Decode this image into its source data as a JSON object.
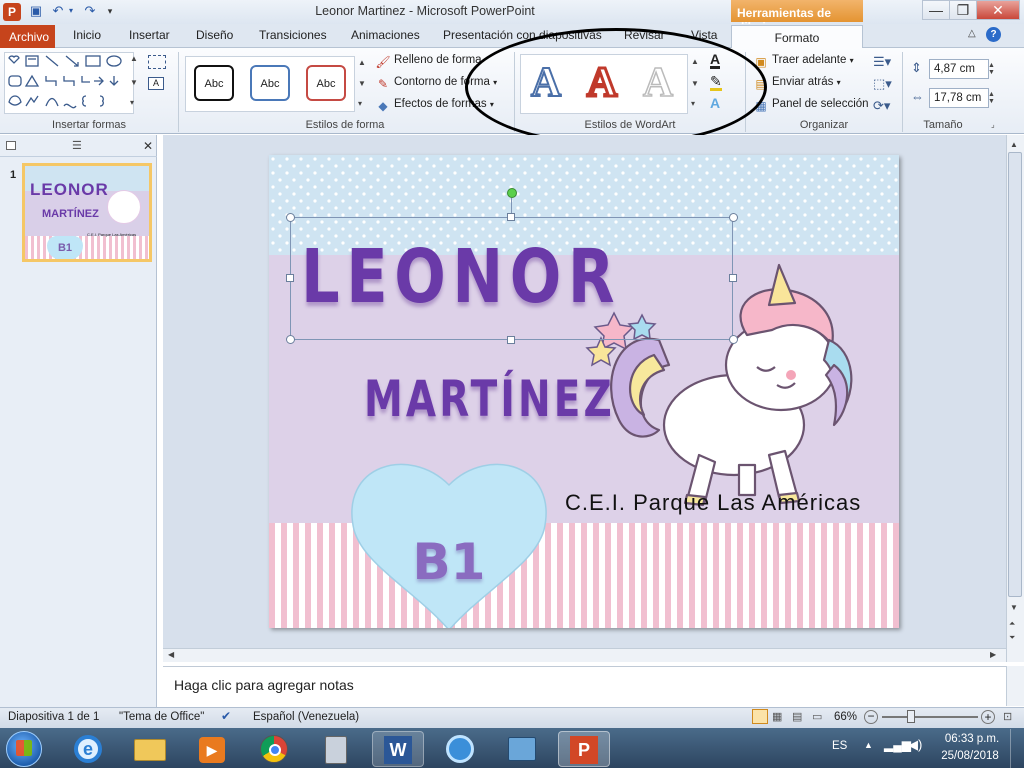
{
  "window": {
    "title": "Leonor Martinez  -  Microsoft PowerPoint",
    "context_tab_group": "Herramientas de dibujo",
    "min_symbol": "—",
    "max_symbol": "❐",
    "close_symbol": "✕"
  },
  "tabs": {
    "file": "Archivo",
    "items": [
      "Inicio",
      "Insertar",
      "Diseño",
      "Transiciones",
      "Animaciones",
      "Presentación con diapositivas",
      "Revisar",
      "Vista"
    ],
    "active": "Formato"
  },
  "ribbon": {
    "groups": {
      "insert_shapes": "Insertar formas",
      "shape_styles": "Estilos de forma",
      "wordart_styles": "Estilos de WordArt",
      "arrange": "Organizar",
      "size": "Tamaño"
    },
    "shape_style_buttons": [
      "Abc",
      "Abc",
      "Abc"
    ],
    "shape_fill": "Relleno de forma",
    "shape_outline": "Contorno de forma",
    "shape_effects": "Efectos de formas",
    "wordart_letters": [
      "A",
      "A",
      "A"
    ],
    "bring_forward": "Traer adelante",
    "send_backward": "Enviar atrás",
    "selection_pane": "Panel de selección",
    "height_value": "4,87 cm",
    "width_value": "17,78 cm"
  },
  "slides_panel": {
    "slide_number": "1",
    "thumb_line1": "LEONOR",
    "thumb_line2": "MARTÍNEZ",
    "thumb_badge": "B1",
    "thumb_school": "C.E.I. Parque Las Américas"
  },
  "slide": {
    "first_name": "LEONOR",
    "last_name": "MARTÍNEZ",
    "school": "C.E.I.  Parque  Las  Américas",
    "badge": "B1"
  },
  "notes": {
    "placeholder": "Haga clic para agregar notas"
  },
  "status": {
    "slide_info": "Diapositiva 1 de 1",
    "theme": "\"Tema de Office\"",
    "language": "Español (Venezuela)",
    "zoom": "66%"
  },
  "taskbar": {
    "lang": "ES",
    "time": "06:33 p.m.",
    "date": "25/08/2018"
  },
  "colors": {
    "accent_file_tab": "#c6441c",
    "context_tab": "#e49432",
    "purple_text": "#6a3aa8",
    "slide_sky": "#cfe4f2",
    "slide_lilac": "#ddd1e8",
    "slide_pink_stripe": "#f1bfd0",
    "heart": "#bfe6f7"
  }
}
